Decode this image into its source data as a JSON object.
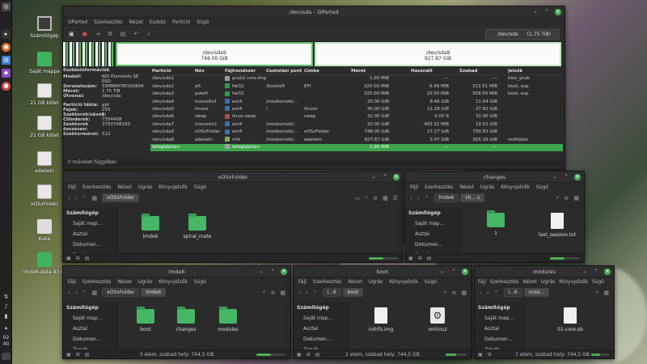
{
  "desktop": {
    "icons": [
      {
        "label": "Számítógép"
      },
      {
        "label": "Saját mappa"
      },
      {
        "label": "21 GB kötet"
      },
      {
        "label": "21 GB kötet"
      },
      {
        "label": "adatwin"
      },
      {
        "label": "xOSxFolder"
      },
      {
        "label": "Kuka"
      },
      {
        "label": "lmde6-data-9339"
      }
    ]
  },
  "taskbar": {
    "clock_hour": "02",
    "clock_min": "40"
  },
  "gparted": {
    "title": "/dev/sda – GParted",
    "menu": [
      "GParted",
      "Szerkesztés",
      "Nézet",
      "Eszköz",
      "Partíció",
      "Súgó"
    ],
    "device_select": {
      "name": "/dev/sda",
      "size": "(1.75 TiB)"
    },
    "map": [
      {
        "name": "/dev/sda9",
        "size": "748.00 GiB"
      },
      {
        "name": "/dev/sda8",
        "size": "927.87 GiB"
      }
    ],
    "info": {
      "heading": "Eszközinformációk",
      "rows1": [
        {
          "k": "Modell:",
          "v": "WD Elements SE SSD"
        },
        {
          "k": "Sorozatszám:",
          "v": "55MNNY0R100804"
        },
        {
          "k": "Méret:",
          "v": "1.75 TiB"
        },
        {
          "k": "Útvonal:",
          "v": "/dev/sda"
        }
      ],
      "rows2": [
        {
          "k": "Partíció tábla:",
          "v": "gpt"
        },
        {
          "k": "Fejek:",
          "v": "255"
        },
        {
          "k": "Szektorok/sávok:",
          "v": "2"
        },
        {
          "k": "Cilinderek:",
          "v": "7354408"
        },
        {
          "k": "Szektorok összesen:",
          "v": "3750748160"
        },
        {
          "k": "Szektorméret:",
          "v": "512"
        }
      ]
    },
    "columns": [
      "Partíció",
      "Név",
      "Fájlrendszer",
      "Csatolási pont",
      "Címke",
      "Méret",
      "Használt",
      "Szabad",
      "Jelzők"
    ],
    "rows": [
      {
        "part": "/dev/sda1",
        "name": "",
        "fs": "grub2 core.img",
        "color": "#9a9a9a",
        "mount": "",
        "label": "",
        "size": "1.00 MiB",
        "used": "---",
        "free": "---",
        "flags": "bios_grub"
      },
      {
        "part": "/dev/sda2",
        "name": "efi",
        "fs": "fat32",
        "color": "#2d9c52",
        "mount": "/boot/efi",
        "label": "EFI",
        "size": "320.00 MiB",
        "used": "6.49 MiB",
        "free": "313.51 MiB",
        "flags": "boot, esp"
      },
      {
        "part": "/dev/sda3",
        "name": "potefi",
        "fs": "fat32",
        "color": "#2d9c52",
        "mount": "",
        "label": "",
        "size": "320.00 MiB",
        "used": "10.50 MiB",
        "free": "309.50 MiB",
        "flags": "boot, esp"
      },
      {
        "part": "/dev/sda4",
        "name": "honosito1",
        "fs": "ext4",
        "color": "#3b6fb0",
        "mount": "/media/noki/...",
        "label": "",
        "size": "20.00 GiB",
        "used": "8.46 GiB",
        "free": "11.54 GiB",
        "flags": ""
      },
      {
        "part": "/dev/sda5",
        "name": "linuxx",
        "fs": "ext4",
        "color": "#3b6fb0",
        "mount": "/",
        "label": "linuxx",
        "size": "40.00 GiB",
        "used": "12.18 GiB",
        "free": "27.82 GiB",
        "flags": ""
      },
      {
        "part": "/dev/sda6",
        "name": "swap",
        "fs": "linux-swap",
        "color": "#b04a4a",
        "mount": "",
        "label": "swap",
        "size": "32.00 GiB",
        "used": "0.00 B",
        "free": "32.00 GiB",
        "flags": ""
      },
      {
        "part": "/dev/sda7",
        "name": "honosito2",
        "fs": "ext4",
        "color": "#3b6fb0",
        "mount": "/media/noki/...",
        "label": "",
        "size": "20.00 GiB",
        "used": "493.32 MiB",
        "free": "19.52 GiB",
        "flags": ""
      },
      {
        "part": "/dev/sda9",
        "name": "xOSxFolder",
        "fs": "ext4",
        "color": "#3b6fb0",
        "mount": "/media/noki/...",
        "label": "xOSxFolder",
        "size": "748.00 GiB",
        "used": "17.17 GiB",
        "free": "730.83 GiB",
        "flags": ""
      },
      {
        "part": "/dev/sda8",
        "name": "adatwin",
        "fs": "ntfs",
        "color": "#7ab058",
        "mount": "/media/noki/...",
        "label": "adatwin",
        "size": "927.87 GiB",
        "used": "2.47 GiB",
        "free": "925.39 GiB",
        "flags": "msftdata"
      },
      {
        "part": "lefoglalatlan",
        "name": "",
        "fs": "lefoglalatlan",
        "color": "#a0a0a0",
        "mount": "",
        "label": "",
        "size": "1.00 MiB",
        "used": "---",
        "free": "---",
        "flags": ""
      }
    ],
    "status": "0 művelet függőben"
  },
  "fm_menu": [
    "Fájl",
    "Szerkesztés",
    "Nézet",
    "Ugrás",
    "Könyvjelzők",
    "Súgó"
  ],
  "fm_sidebar": {
    "head": "Számítógép",
    "items": [
      "Saját map...",
      "Asztal",
      "Dokumen...",
      "Zenék"
    ]
  },
  "win_xosx": {
    "title": "xOSxFolder",
    "crumbs": [
      "xOSxFolder"
    ],
    "files": [
      {
        "name": "lmde6"
      },
      {
        "name": "spiral_mate"
      }
    ],
    "status": "2 elem, szabad hely: 744,5 GB"
  },
  "win_changes": {
    "title": "changes",
    "crumbs": [
      "lmde6",
      "ch... s"
    ],
    "files": [
      {
        "name": "1"
      },
      {
        "name": "last_session.txt"
      }
    ],
    "status": "2 elem, szabad hely: 744,5 GB"
  },
  "win_lmde6": {
    "title": "lmde6",
    "crumbs": [
      "xOSxFolder",
      "lmde6"
    ],
    "files": [
      {
        "name": "boot"
      },
      {
        "name": "changes"
      },
      {
        "name": "modules"
      }
    ],
    "status": "3 elem, szabad hely: 744,5 GB"
  },
  "win_boot": {
    "title": "boot",
    "crumbs": [
      "l...6",
      "boot"
    ],
    "files": [
      {
        "name": "initrfs.img"
      },
      {
        "name": "vmlinuz"
      }
    ],
    "status": "2 elem, szabad hely: 744,5 GB"
  },
  "win_modules": {
    "title": "modules",
    "crumbs": [
      "l...6",
      "mod..."
    ],
    "files": [
      {
        "name": "01-core.sb"
      }
    ],
    "status": "1 elem, szabad hely: 744,5 GB"
  }
}
